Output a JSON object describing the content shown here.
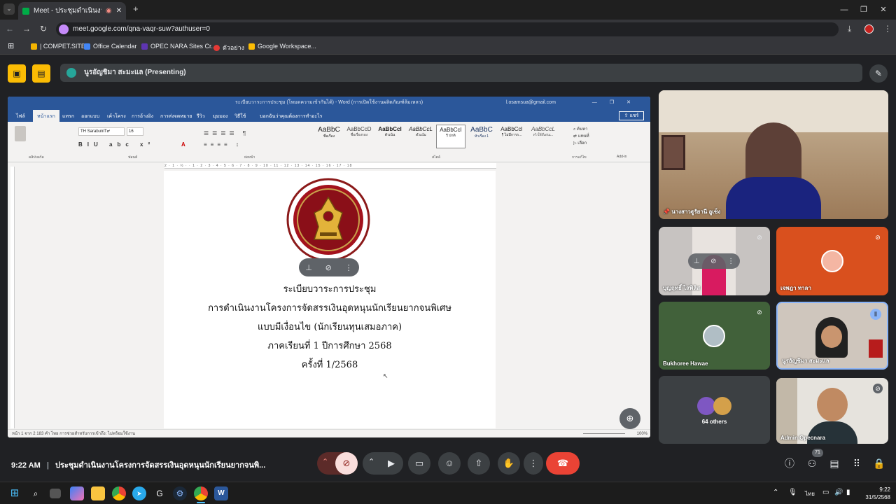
{
  "browser": {
    "tab_title": "Meet - ประชุมดำเนินงานโครงการ",
    "new_tab": "+",
    "url": "meet.google.com/qna-vaqr-suw?authuser=0",
    "bookmarks": [
      "| COMPET.SITE",
      "Office Calendar",
      "OPEC NARA Sites Cr...",
      "ตัวอย่าง",
      "Google Workspace..."
    ]
  },
  "meet": {
    "presenter_label": "นูรอัญชิมา สะมะแล (Presenting)",
    "time": "9:22 AM",
    "meeting_title": "ประชุมดำเนินงานโครงการจัดสรรเงินอุดหนุนนักเรียนยากจนพิ...",
    "people_count": "71",
    "participants": [
      {
        "name": "นางสาวฐูรัยานี อูเซ็ง"
      },
      {
        "name": "บุญฤทธิ์ ไสพิลิส"
      },
      {
        "name": "เจพฎา ทาลา"
      },
      {
        "name": "Bukhoree Hawae"
      },
      {
        "name": "นูรอัญชิมา สะมะแล"
      },
      {
        "name": "64 others"
      },
      {
        "name": "Admin Opecnara"
      }
    ]
  },
  "word": {
    "title_bar": "ระเบียบวาระการประชุม (โหมดความเข้ากันได้) - Word (การเปิดใช้งานผลิตภัณฑ์ล้มเหลว)",
    "account": "l.osamsua@gmail.com",
    "tabs": [
      "ไฟล์",
      "หน้าแรก",
      "แทรก",
      "ออกแบบ",
      "เค้าโครง",
      "การอ้างอิง",
      "การส่งจดหมาย",
      "รีวิว",
      "มุมมอง",
      "วิธีใช้",
      "บอกฉันว่าคุณต้องการทำอะไร"
    ],
    "share": "แชร์",
    "font_name": "TH SarabunIT๙",
    "font_size": "16",
    "styles": [
      {
        "preview": "AaBbC",
        "name": "ชื่อเรื่อง"
      },
      {
        "preview": "AaBbCcD",
        "name": "ชื่อเรื่องรอง"
      },
      {
        "preview": "AaBbCcI",
        "name": "ตัวเน้น"
      },
      {
        "preview": "AaBbCcL",
        "name": "ตัวเน้น"
      },
      {
        "preview": "AaBbCcI",
        "name": "¶ ปกติ"
      },
      {
        "preview": "AaBbC",
        "name": "หัวเรื่อง 1"
      },
      {
        "preview": "AaBbCcI",
        "name": "¶ ไม่มีการร..."
      },
      {
        "preview": "AaBbCcL",
        "name": "ทำให้ดีเด่นเ..."
      }
    ],
    "groups": [
      "คลิปบอร์ด",
      "ฟอนต์",
      "ย่อหน้า",
      "สไตล์",
      "การแก้ไข",
      "Add-in"
    ],
    "edit_items": [
      "ค้นหา",
      "แทนที่",
      "เลือก"
    ],
    "ruler_text": "2 · 1 · ½ · · 1 · 2 · 3 · 4 · 5 · 6 · 7 · 8 · 9 · 10 · 11 · 12 · 13 · 14 · 15 · 16 · 17 · 18",
    "status": "หน้า 1 จาก 2    183 คำ    ไทย    การช่วยสำหรับการเข้าถึง: ไม่พร้อมใช้งาน",
    "zoom": "100%",
    "document_lines": [
      "ระเบียบวาระการประชุม",
      "การดำเนินงานโครงการจัดสรรเงินอุดหนุนนักเรียนยากจนพิเศษ",
      "แบบมีเงื่อนไข (นักเรียนทุนเสมอภาค)",
      "ภาคเรียนที่ 1 ปีการศึกษา 2568",
      "ครั้งที่ 1/2568"
    ]
  },
  "taskbar": {
    "lang": "ไทย",
    "time": "9:22",
    "date": "31/5/2568"
  }
}
